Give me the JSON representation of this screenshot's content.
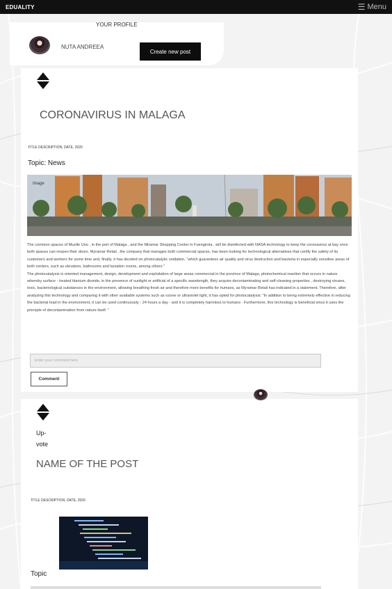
{
  "app": {
    "brand": "EDUALITY",
    "menu_label": "Menu"
  },
  "profile": {
    "title": "YOUR PROFILE",
    "name": "NUTA ANDREEA",
    "create_button": "Create new post"
  },
  "posts": [
    {
      "title": "CORONAVIRUS IN MALAGA",
      "description": "TITLE DESCRIPTION, DATE, 2020",
      "topic": "Topic: News",
      "image_label": "Image",
      "body": [
        "The common spaces of Muelle Uno , in the port of Malaga , and the Miramar Shopping Center in Fuengirola , will be disinfected with NASA technology to keep the coronavirus at bay once both spaces can reopen their doors. Myramar Retail , the company that manages both commercial spaces, has been looking for technological alternatives that certify the safety of its customers and workers for some time and, finally, it has decided on photocatalytic oxidation, \"which guarantees air quality and virus destruction and bacteria in especially sensitive areas of both centers, such as elevators, bathrooms and lactation rooms, among others \"",
        "The photocatalysis is oriented management, design, development and exploitation of large areas commercial in the province of Malaga, photochemical reaction that occurs in nature whereby surface - treated titanium dioxide, in the presence of sunlight or artificial of a specific wavelength, they acquire decontaminating and self-cleaning properties , destroying viruses, toxic, bacteriological substances in the environment, allowing breathing fresh air and therefore more benefits for humans, as Myramar Retail has indicated in a statement. Therefore, after analyzing this technology and comparing it with other available systems such as ozone or ultraviolet light, it has opted for photocatalysis: \"In addition to being extremely effective in reducing the bacterial load in the environment, it can be used continuously - 24 hours a day - and it is completely harmless to humans . Furthermore, this technology is beneficial since it uses the principle of decontamination from nature itself. \""
      ],
      "comment_placeholder": "Enter your comment here",
      "comment_button": "Comment"
    },
    {
      "upvote_label": "Up-vote",
      "title": "NAME OF THE POST",
      "description": "TITLE DESCRIPTION, DATE, 2020",
      "topic": "Topic"
    }
  ]
}
